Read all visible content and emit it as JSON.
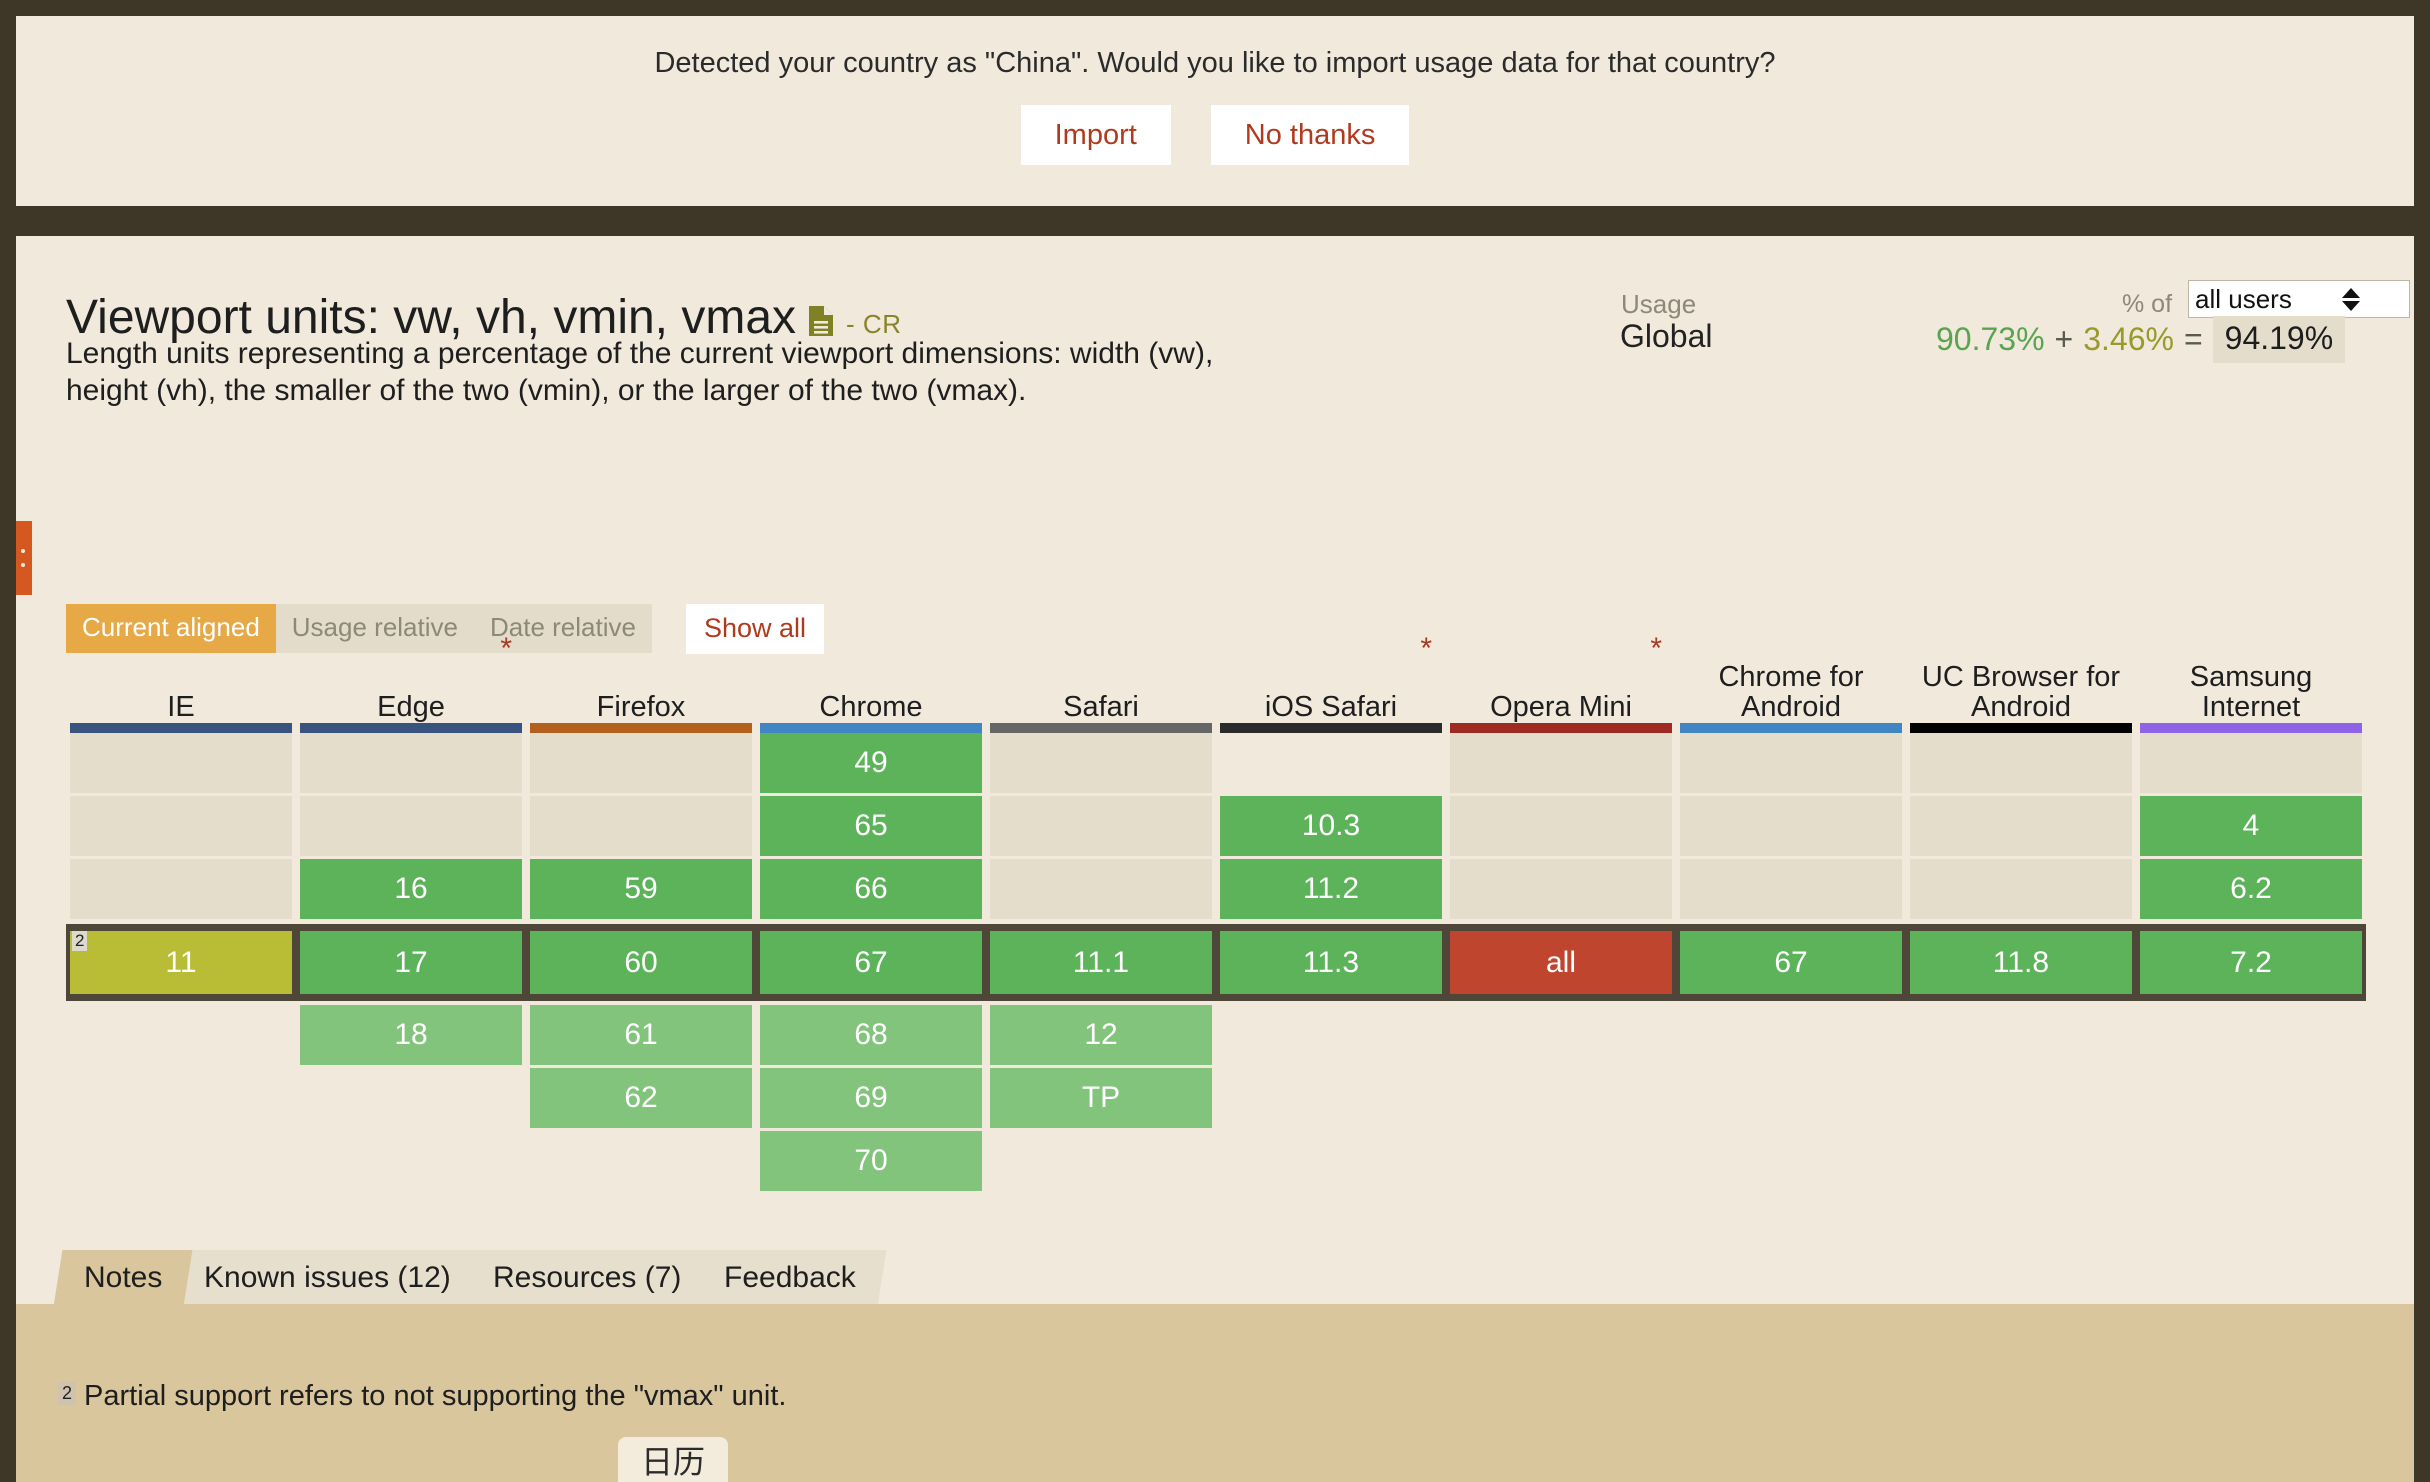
{
  "notification": {
    "message": "Detected your country as \"China\". Would you like to import usage data for that country?",
    "import_label": "Import",
    "decline_label": "No thanks"
  },
  "feature": {
    "title": "Viewport units: vw, vh, vmin, vmax",
    "spec_icon": "document-icon",
    "status": "- CR",
    "description": "Length units representing a percentage of the current viewport dimensions: width (vw), height (vh), the smaller of the two (vmin), or the larger of the two (vmax)."
  },
  "usage": {
    "label": "Usage",
    "scope": "Global",
    "pct_of_label": "% of",
    "audience": "all users",
    "full_support": "90.73%",
    "plus": "+",
    "partial_support": "3.46%",
    "equals": "=",
    "total": "94.19%"
  },
  "view_modes": [
    {
      "label": "Current aligned",
      "active": true
    },
    {
      "label": "Usage relative",
      "active": false
    },
    {
      "label": "Date relative",
      "active": false
    }
  ],
  "show_all_label": "Show all",
  "browser_columns": [
    {
      "name": "IE",
      "note": "",
      "color": "#39537f"
    },
    {
      "name": "Edge",
      "note": "*",
      "color": "#39537f"
    },
    {
      "name": "Firefox",
      "note": "",
      "color": "#b2601b"
    },
    {
      "name": "Chrome",
      "note": "",
      "color": "#4285c5"
    },
    {
      "name": "Safari",
      "note": "",
      "color": "#666666"
    },
    {
      "name": "iOS Safari",
      "note": "*",
      "color": "#2b2b2b"
    },
    {
      "name": "Opera Mini",
      "note": "*",
      "color": "#9e2a22"
    },
    {
      "name": "Chrome for Android",
      "note": "",
      "color": "#4285c5"
    },
    {
      "name": "UC Browser for Android",
      "note": "",
      "color": "#000000"
    },
    {
      "name": "Samsung Internet",
      "note": "",
      "color": "#8e63e8"
    }
  ],
  "chart_data": {
    "type": "table",
    "title": "Browser support grid for Viewport units",
    "legend": {
      "full": "#5cb35a",
      "partial": "#b9bd36",
      "future": "#82c47c",
      "none": "#c0452f",
      "unknown": "#e5ddcc"
    },
    "columns": [
      "IE",
      "Edge",
      "Firefox",
      "Chrome",
      "Safari",
      "iOS Safari",
      "Opera Mini",
      "Chrome for Android",
      "UC Browser for Android",
      "Samsung Internet"
    ],
    "rows_past": [
      [
        {
          "v": "",
          "s": "empty"
        },
        {
          "v": "",
          "s": "empty"
        },
        {
          "v": "",
          "s": "empty"
        },
        {
          "v": "49",
          "s": "g"
        },
        {
          "v": "",
          "s": "empty"
        },
        {
          "v": "",
          "s": "blank"
        },
        {
          "v": "",
          "s": "empty"
        },
        {
          "v": "",
          "s": "empty"
        },
        {
          "v": "",
          "s": "empty"
        },
        {
          "v": "",
          "s": "empty"
        }
      ],
      [
        {
          "v": "",
          "s": "empty"
        },
        {
          "v": "",
          "s": "empty"
        },
        {
          "v": "",
          "s": "empty"
        },
        {
          "v": "65",
          "s": "g"
        },
        {
          "v": "",
          "s": "empty"
        },
        {
          "v": "10.3",
          "s": "g"
        },
        {
          "v": "",
          "s": "empty"
        },
        {
          "v": "",
          "s": "empty"
        },
        {
          "v": "",
          "s": "empty"
        },
        {
          "v": "4",
          "s": "g"
        }
      ],
      [
        {
          "v": "",
          "s": "empty"
        },
        {
          "v": "16",
          "s": "g"
        },
        {
          "v": "59",
          "s": "g"
        },
        {
          "v": "66",
          "s": "g"
        },
        {
          "v": "",
          "s": "empty"
        },
        {
          "v": "11.2",
          "s": "g"
        },
        {
          "v": "",
          "s": "empty"
        },
        {
          "v": "",
          "s": "empty"
        },
        {
          "v": "",
          "s": "empty"
        },
        {
          "v": "6.2",
          "s": "g"
        }
      ]
    ],
    "row_current": [
      {
        "v": "11",
        "s": "y",
        "note": "2"
      },
      {
        "v": "17",
        "s": "g"
      },
      {
        "v": "60",
        "s": "g"
      },
      {
        "v": "67",
        "s": "g"
      },
      {
        "v": "11.1",
        "s": "g"
      },
      {
        "v": "11.3",
        "s": "g"
      },
      {
        "v": "all",
        "s": "r"
      },
      {
        "v": "67",
        "s": "g"
      },
      {
        "v": "11.8",
        "s": "g"
      },
      {
        "v": "7.2",
        "s": "g"
      }
    ],
    "rows_future": [
      [
        {
          "v": "",
          "s": "blank"
        },
        {
          "v": "18",
          "s": "gl"
        },
        {
          "v": "61",
          "s": "gl"
        },
        {
          "v": "68",
          "s": "gl"
        },
        {
          "v": "12",
          "s": "gl"
        },
        {
          "v": "",
          "s": "blank"
        },
        {
          "v": "",
          "s": "blank"
        },
        {
          "v": "",
          "s": "blank"
        },
        {
          "v": "",
          "s": "blank"
        },
        {
          "v": "",
          "s": "blank"
        }
      ],
      [
        {
          "v": "",
          "s": "blank"
        },
        {
          "v": "",
          "s": "blank"
        },
        {
          "v": "62",
          "s": "gl"
        },
        {
          "v": "69",
          "s": "gl"
        },
        {
          "v": "TP",
          "s": "gl"
        },
        {
          "v": "",
          "s": "blank"
        },
        {
          "v": "",
          "s": "blank"
        },
        {
          "v": "",
          "s": "blank"
        },
        {
          "v": "",
          "s": "blank"
        },
        {
          "v": "",
          "s": "blank"
        }
      ],
      [
        {
          "v": "",
          "s": "blank"
        },
        {
          "v": "",
          "s": "blank"
        },
        {
          "v": "",
          "s": "blank"
        },
        {
          "v": "70",
          "s": "gl"
        },
        {
          "v": "",
          "s": "blank"
        },
        {
          "v": "",
          "s": "blank"
        },
        {
          "v": "",
          "s": "blank"
        },
        {
          "v": "",
          "s": "blank"
        },
        {
          "v": "",
          "s": "blank"
        },
        {
          "v": "",
          "s": "blank"
        }
      ]
    ]
  },
  "bottom_tabs": [
    {
      "label": "Notes",
      "active": true
    },
    {
      "label": "Known issues (12)",
      "active": false
    },
    {
      "label": "Resources (7)",
      "active": false
    },
    {
      "label": "Feedback",
      "active": false
    }
  ],
  "note": {
    "marker": "2",
    "text": "Partial support refers to not supporting the \"vmax\" unit."
  },
  "ime": {
    "candidate": "日历"
  }
}
